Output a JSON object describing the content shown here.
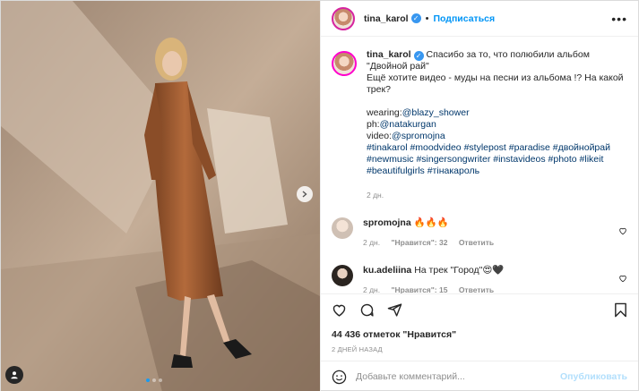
{
  "header": {
    "username": "tina_karol",
    "separator": "•",
    "follow_label": "Подписаться",
    "more_label": "•••"
  },
  "caption": {
    "username": "tina_karol",
    "line1": "Спасибо за то, что полюбили альбом \"Двойной рай\"",
    "line2": "Ещё хотите видео - муды на песни из альбома !? На какой трек?",
    "wearing_prefix": "wearing:",
    "wearing_link": "@blazy_shower",
    "ph_prefix": "ph:",
    "ph_link": "@natakurgan",
    "video_prefix": "video:",
    "video_link": "@spromojna",
    "hashtags_1": "#tinakarol #moodvideo #stylepost #paradise #двойнойрай",
    "hashtags_2": "#newmusic #singersongwriter #instavideos #photo #likeit",
    "hashtags_3": "#beautifulgirls #тінакароль",
    "time": "2 дн."
  },
  "comments": [
    {
      "username": "spromojna",
      "text": "🔥🔥🔥",
      "time": "2 дн.",
      "likes": "\"Нравится\": 32",
      "reply": "Ответить"
    },
    {
      "username": "ku.adeliina",
      "text": "На трек \"Город\"😍🖤",
      "time": "2 дн.",
      "likes": "\"Нравится\": 15",
      "reply": "Ответить"
    }
  ],
  "likes_label": "44 436 отметок \"Нравится\"",
  "date_label": "2 ДНЕЙ НАЗАД",
  "add_comment": {
    "placeholder": "Добавьте комментарий...",
    "publish_label": "Опубликовать"
  },
  "carousel": {
    "slides": 3,
    "active": 0
  },
  "colors": {
    "link": "#00376b",
    "accent": "#0095f6",
    "muted": "#8e8e8e",
    "publish_disabled": "#b2dffc"
  }
}
